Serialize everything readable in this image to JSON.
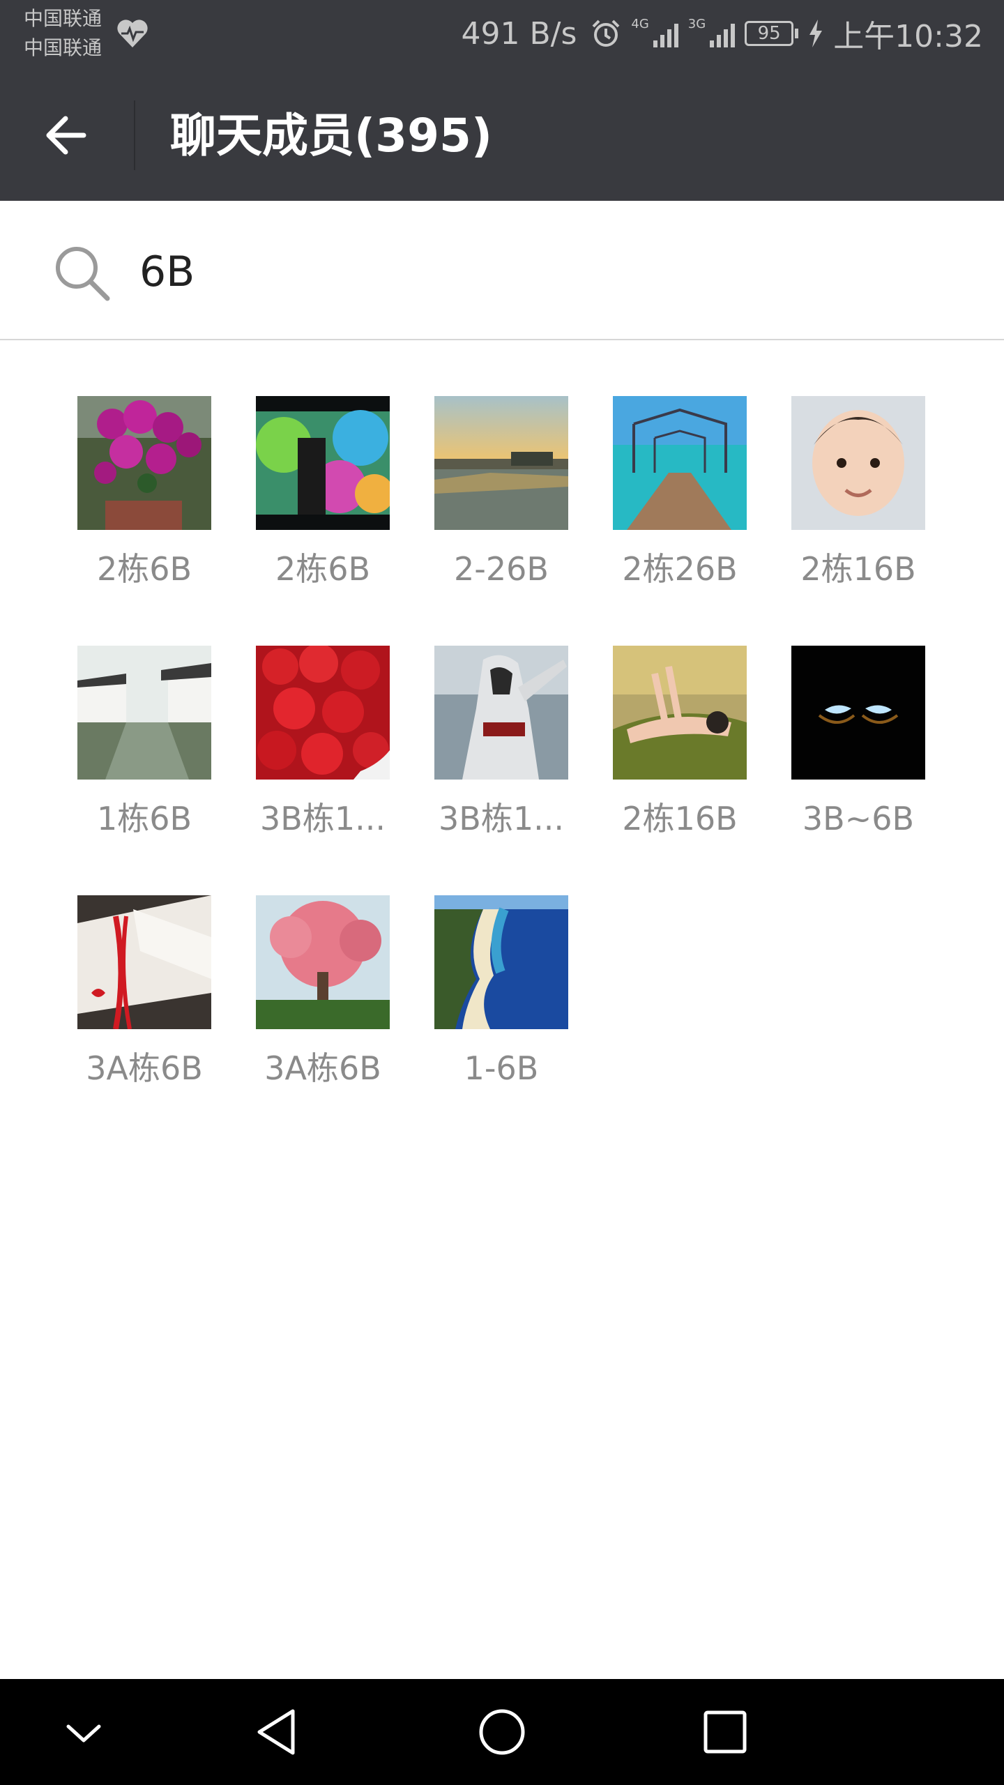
{
  "status_bar": {
    "carrier1": "中国联通",
    "carrier2": "中国联通",
    "net_speed": "491 B/s",
    "signal1_tag": "4G",
    "signal2_tag": "3G",
    "battery": "95",
    "time": "上午10:32",
    "icons": [
      "heart-monitor-icon",
      "alarm-icon",
      "signal-icon",
      "battery-icon",
      "charging-icon"
    ]
  },
  "app_bar": {
    "title": "聊天成员(395)",
    "back_icon": "arrow-left-icon"
  },
  "search": {
    "icon": "search-icon",
    "value": "6B"
  },
  "members": [
    {
      "name": "2栋6B",
      "avatar": "purple-orchid"
    },
    {
      "name": "2栋6B",
      "avatar": "blurry-screen"
    },
    {
      "name": "2-26B",
      "avatar": "sunset-river"
    },
    {
      "name": "2栋26B",
      "avatar": "pier-sea"
    },
    {
      "name": "2栋16B",
      "avatar": "baby-face"
    },
    {
      "name": "1栋6B",
      "avatar": "water-town"
    },
    {
      "name": "3B栋1...",
      "avatar": "strawberries"
    },
    {
      "name": "3B栋1...",
      "avatar": "hooded-figure"
    },
    {
      "name": "2栋16B",
      "avatar": "woman-grass"
    },
    {
      "name": "3B~6B",
      "avatar": "glowing-eyes"
    },
    {
      "name": "3A栋6B",
      "avatar": "love-card"
    },
    {
      "name": "3A栋6B",
      "avatar": "pink-tree"
    },
    {
      "name": "1-6B",
      "avatar": "beach-coast"
    }
  ],
  "nav_bar": {
    "icons": [
      "chevron-down-icon",
      "back-triangle-icon",
      "home-circle-icon",
      "recents-square-icon"
    ]
  },
  "colors": {
    "bar": "#393a3f",
    "name_text": "#8a8a8a",
    "nav": "#000000"
  }
}
